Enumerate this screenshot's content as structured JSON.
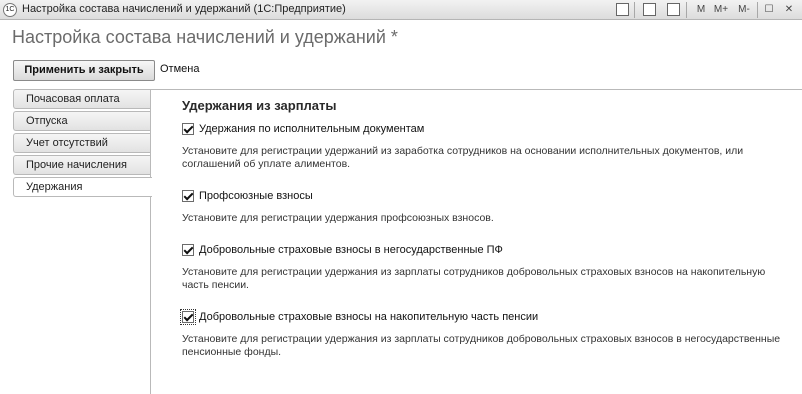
{
  "window": {
    "app_logo": "1С",
    "title": "Настройка состава начислений и удержаний  (1С:Предприятие)",
    "controls": {
      "m": "M",
      "m_plus": "M+",
      "m_minus": "M-",
      "minimize": "—",
      "restore": "☐",
      "close": "✕"
    }
  },
  "page_title": "Настройка состава начислений и удержаний *",
  "toolbar": {
    "apply_label": "Применить и закрыть",
    "cancel_label": "Отмена"
  },
  "tabs": [
    {
      "label": "Почасовая оплата"
    },
    {
      "label": "Отпуска"
    },
    {
      "label": "Учет отсутствий"
    },
    {
      "label": "Прочие начисления"
    },
    {
      "label": "Удержания",
      "active": true
    }
  ],
  "section": {
    "title": "Удержания из зарплаты",
    "options": [
      {
        "label": "Удержания по исполнительным документам",
        "checked": true,
        "description": "Установите для регистрации удержаний из заработка сотрудников на основании исполнительных документов, или соглашений об уплате алиментов."
      },
      {
        "label": "Профсоюзные взносы",
        "checked": true,
        "description": "Установите для регистрации удержания профсоюзных взносов."
      },
      {
        "label": "Добровольные страховые взносы в негосударственные ПФ",
        "checked": true,
        "description": "Установите для регистрации удержания из зарплаты сотрудников добровольных страховых взносов на накопительную часть пенсии."
      },
      {
        "label": "Добровольные страховые взносы на накопительную часть пенсии",
        "checked": true,
        "description": "Установите для регистрации удержания из зарплаты сотрудников добровольных страховых взносов в негосударственные пенсионные фонды."
      }
    ]
  }
}
